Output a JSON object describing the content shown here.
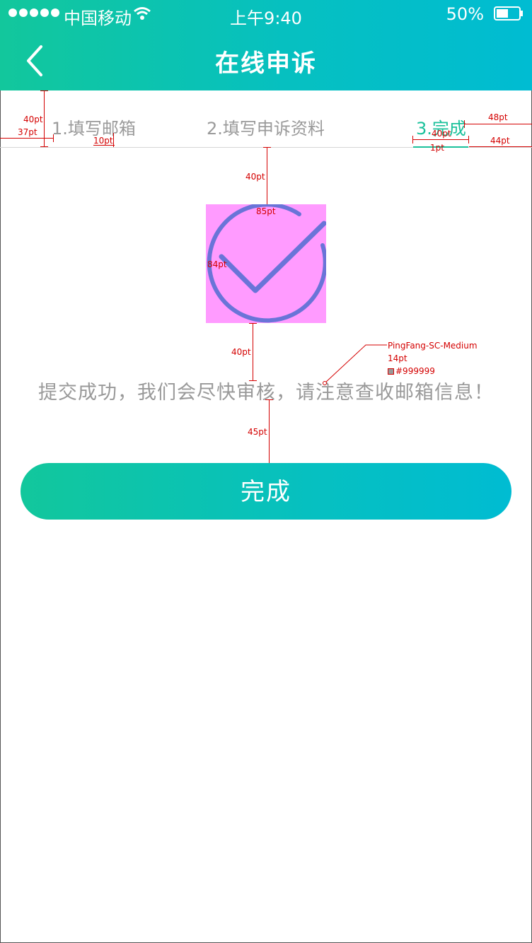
{
  "status_bar": {
    "carrier": "中国移动",
    "time": "上午9:40",
    "battery": "50%"
  },
  "nav": {
    "title": "在线申诉",
    "back_icon": "chevron-left-icon"
  },
  "steps": [
    {
      "label": "1.填写邮箱",
      "active": false
    },
    {
      "label": "2.填写申诉资料",
      "active": false
    },
    {
      "label": "3.完成",
      "active": true
    }
  ],
  "result": {
    "icon": "success-check-icon",
    "message": "提交成功，我们会尽快审核，请注意查收邮箱信息！"
  },
  "done_button": {
    "label": "完成"
  },
  "colors": {
    "gradient_start": "#12c79c",
    "gradient_end": "#00bcd2",
    "active_step": "#1bc19b",
    "message_text": "#999999",
    "icon_stroke": "#6a74d8",
    "icon_box": "#ff9bff",
    "annotation": "#d40000"
  },
  "annotations": {
    "step_top": "40pt",
    "step_left": "37pt",
    "step_gap": "10pt",
    "step3_right": "48pt",
    "step3_width": "40pt",
    "underline_height": "1pt",
    "underline_right": "44pt",
    "icon_top": "40pt",
    "icon_width": "85pt",
    "icon_height": "84pt",
    "text_top": "40pt",
    "button_top": "45pt",
    "font_name": "PingFang-SC-Medium",
    "font_size": "14pt",
    "font_color": "#999999"
  }
}
